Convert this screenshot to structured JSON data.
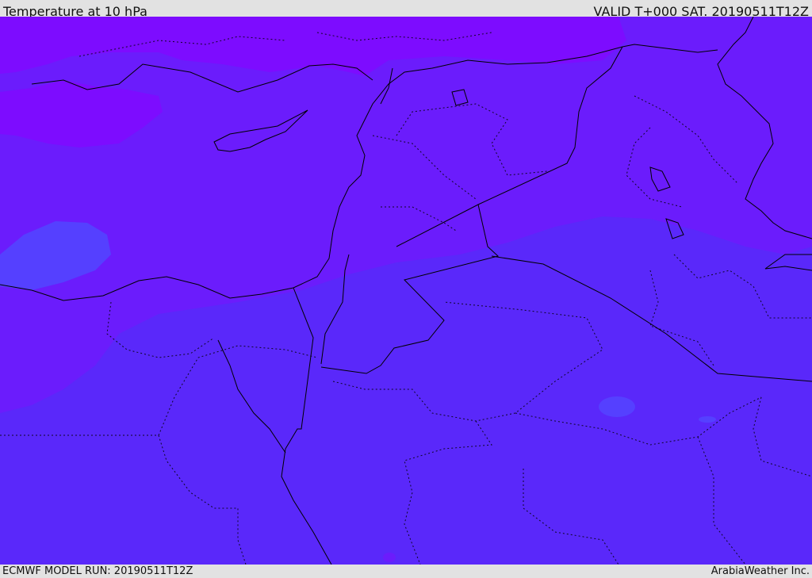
{
  "header": {
    "title": "Temperature at 10 hPa",
    "valid": "VALID T+000 SAT. 20190511T12Z"
  },
  "footer": {
    "model_run": "ECMWF MODEL RUN: 20190511T12Z",
    "credit": "ArabiaWeather Inc."
  },
  "colors": {
    "band_warm": "#5a28fa",
    "band_mid": "#6b1cfc",
    "band_cold": "#7d0cff",
    "band_warmer": "#5540ff",
    "coastline": "#000000"
  }
}
